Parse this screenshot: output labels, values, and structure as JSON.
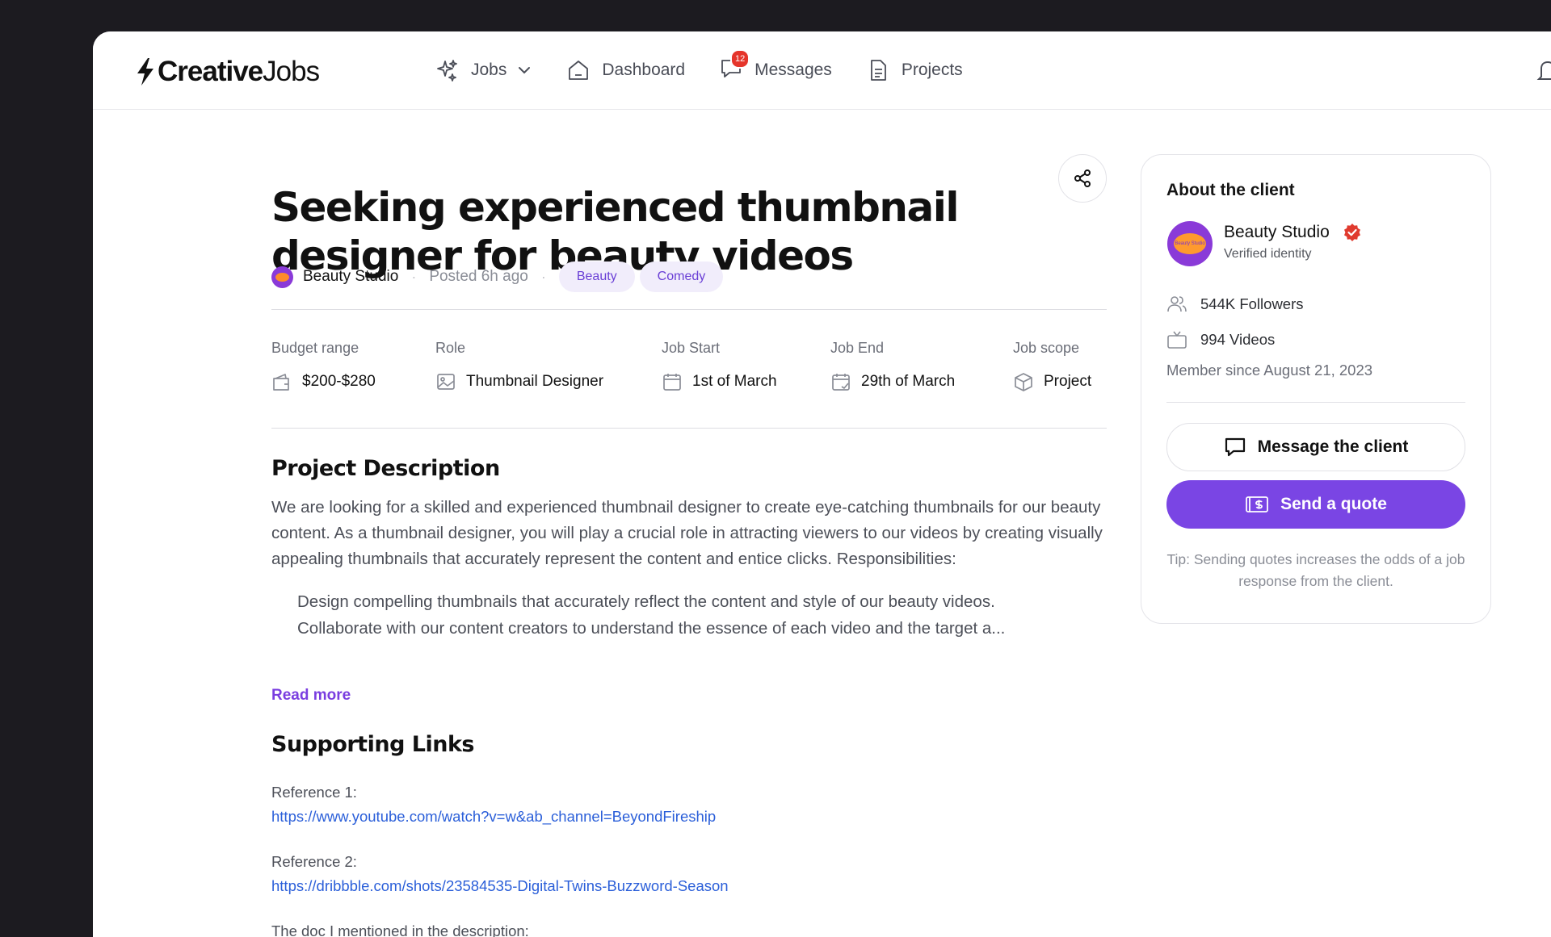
{
  "brand": {
    "logo_bold": "Creative",
    "logo_light": "Jobs"
  },
  "nav": {
    "jobs": "Jobs",
    "dashboard": "Dashboard",
    "messages": "Messages",
    "messages_badge": "12",
    "projects": "Projects"
  },
  "job": {
    "title": "Seeking experienced thumbnail designer for beauty videos",
    "client": "Beauty Studio",
    "posted": "Posted 6h ago",
    "tags": [
      "Beauty",
      "Comedy"
    ]
  },
  "facts": [
    {
      "label": "Budget range",
      "value": "$200-$280",
      "icon": "wallet-icon"
    },
    {
      "label": "Role",
      "value": "Thumbnail Designer",
      "icon": "image-icon"
    },
    {
      "label": "Job Start",
      "value": "1st of March",
      "icon": "calendar-icon"
    },
    {
      "label": "Job End",
      "value": "29th of March",
      "icon": "calendar-check-icon"
    },
    {
      "label": "Job scope",
      "value": "Project",
      "icon": "box-icon"
    }
  ],
  "description": {
    "heading": "Project Description",
    "body": "We are looking for a skilled and experienced thumbnail designer to create eye-catching thumbnails for our beauty content. As a thumbnail designer, you will play a crucial role in attracting viewers to our videos by creating visually appealing thumbnails that accurately represent the content and entice clicks. Responsibilities:",
    "items": [
      "Design compelling thumbnails that accurately reflect the content and style of our beauty videos.",
      "Collaborate with our content creators to understand the essence of each video and the target a..."
    ],
    "read_more": "Read more"
  },
  "links": {
    "heading": "Supporting Links",
    "refs": [
      {
        "label": "Reference 1:",
        "url": "https://www.youtube.com/watch?v=w&ab_channel=BeyondFireship"
      },
      {
        "label": "Reference 2:",
        "url": "https://dribbble.com/shots/23584535-Digital-Twins-Buzzword-Season"
      }
    ],
    "doc_label": "The doc I mentioned in the description:"
  },
  "client_card": {
    "title": "About the client",
    "name": "Beauty Studio",
    "avatar_text": "Beauty Studio",
    "verified": "Verified identity",
    "followers": "544K Followers",
    "videos": "994 Videos",
    "member_since": "Member since August 21, 2023",
    "message_btn": "Message the client",
    "quote_btn": "Send a quote",
    "tip": "Tip: Sending quotes increases the odds of a job response from the client."
  },
  "colors": {
    "accent": "#7a45e4",
    "link": "#2b5fd9",
    "badge": "#e5352b",
    "verified": "#e03a2e"
  }
}
